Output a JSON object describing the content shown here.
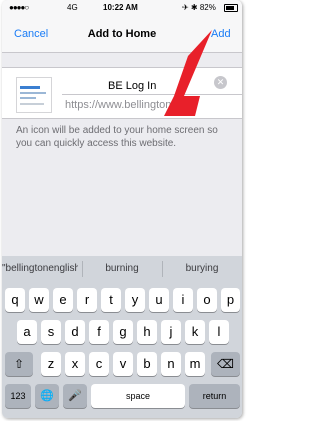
{
  "status_bar": {
    "signal": "●●●●○",
    "network": "4G",
    "time": "10:22 AM",
    "right": "✈ ✱ 82%"
  },
  "nav": {
    "cancel": "Cancel",
    "title": "Add to Home",
    "add": "Add"
  },
  "bookmark": {
    "name": "BE Log In",
    "url": "https://www.bellingtone...",
    "clear_icon": "✕",
    "thumbnail_icon": "site-thumbnail"
  },
  "description": "An icon will be added to your home screen so you can quickly access this website.",
  "annotation": {
    "arrow_color": "#e8202a"
  },
  "suggestions": [
    "\"bellingtonenglish\"",
    "burning",
    "burying"
  ],
  "keyboard": {
    "row1": [
      "q",
      "w",
      "e",
      "r",
      "t",
      "y",
      "u",
      "i",
      "o",
      "p"
    ],
    "row2": [
      "a",
      "s",
      "d",
      "f",
      "g",
      "h",
      "j",
      "k",
      "l"
    ],
    "row3": [
      "z",
      "x",
      "c",
      "v",
      "b",
      "n",
      "m"
    ],
    "shift": "⇧",
    "delete": "⌫",
    "numbers": "123",
    "globe": "🌐",
    "mic": "🎤",
    "space": "space",
    "return": "return"
  },
  "accent_color": "#1a7cf6"
}
